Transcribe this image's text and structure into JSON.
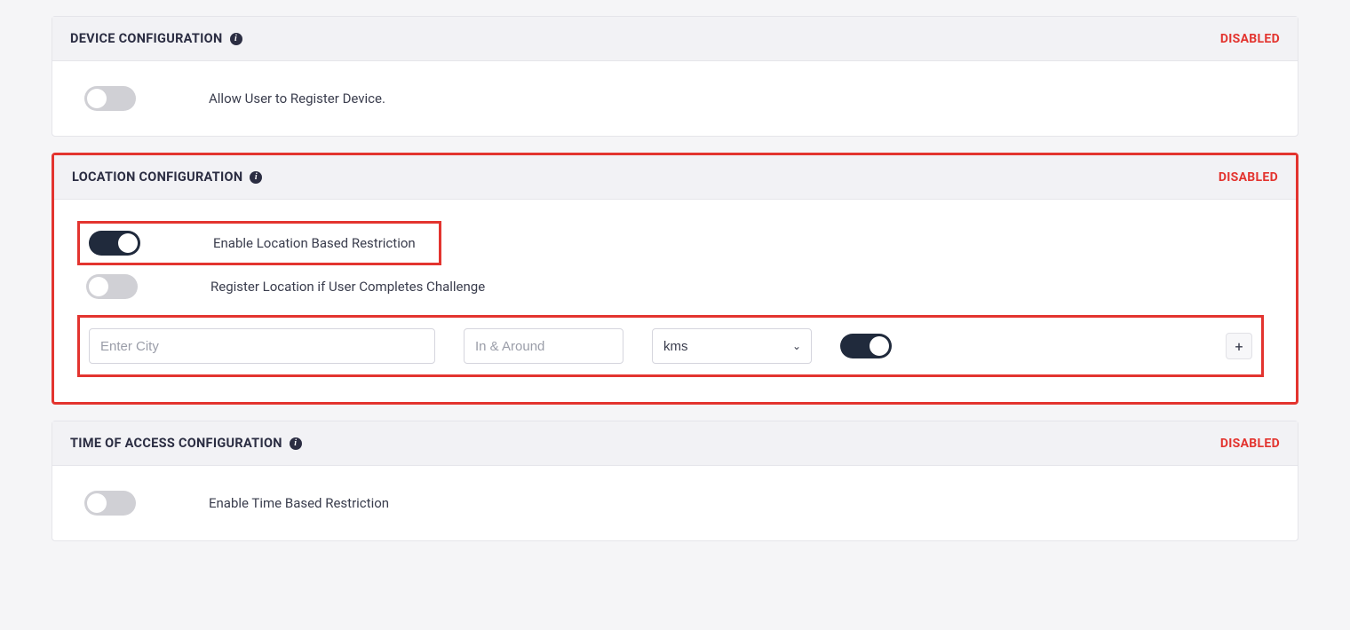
{
  "device_config": {
    "title": "DEVICE CONFIGURATION",
    "status": "DISABLED",
    "allow_register": {
      "label": "Allow User to Register Device.",
      "on": false
    }
  },
  "location_config": {
    "title": "LOCATION CONFIGURATION",
    "status": "DISABLED",
    "enable_restriction": {
      "label": "Enable Location Based Restriction",
      "on": true
    },
    "register_on_challenge": {
      "label": "Register Location if User Completes Challenge",
      "on": false
    },
    "city_input": {
      "placeholder": "Enter City",
      "value": ""
    },
    "around_input": {
      "placeholder": "In & Around",
      "value": ""
    },
    "unit_select": {
      "value": "kms"
    },
    "row_toggle_on": true,
    "add_button": "+"
  },
  "time_config": {
    "title": "TIME OF ACCESS CONFIGURATION",
    "status": "DISABLED",
    "enable_restriction": {
      "label": "Enable Time Based Restriction",
      "on": false
    }
  }
}
